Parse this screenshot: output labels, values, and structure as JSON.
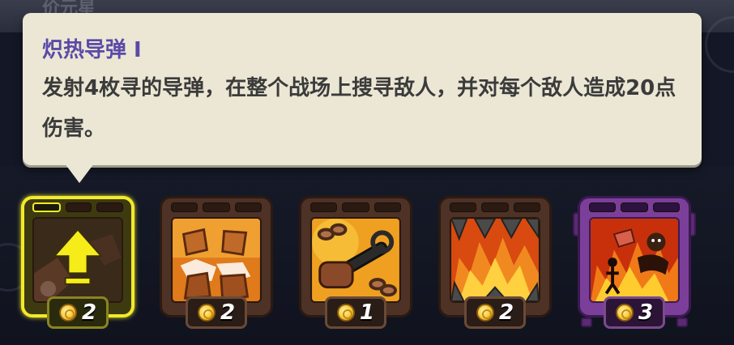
{
  "background": {
    "header_label": "价元星"
  },
  "tooltip": {
    "title": "炽热导弹 I",
    "description": "发射4枚寻的导弹，在整个战场上搜寻敌人，并对每个敌人造成20点伤害。"
  },
  "upgrades": [
    {
      "icon": "upgrade-arrow-icon",
      "cost": "2",
      "selected": true
    },
    {
      "icon": "rock-burst-icon",
      "cost": "2",
      "selected": false
    },
    {
      "icon": "chain-fist-icon",
      "cost": "1",
      "selected": false
    },
    {
      "icon": "fire-spikes-icon",
      "cost": "2",
      "selected": false
    },
    {
      "icon": "demon-fire-icon",
      "cost": "3",
      "selected": false
    }
  ],
  "colors": {
    "tooltip_bg": "#ebe7d4",
    "title": "#5a4aa8",
    "selected_border": "#f2ea2a",
    "purple_card": "#7b3f9a"
  }
}
